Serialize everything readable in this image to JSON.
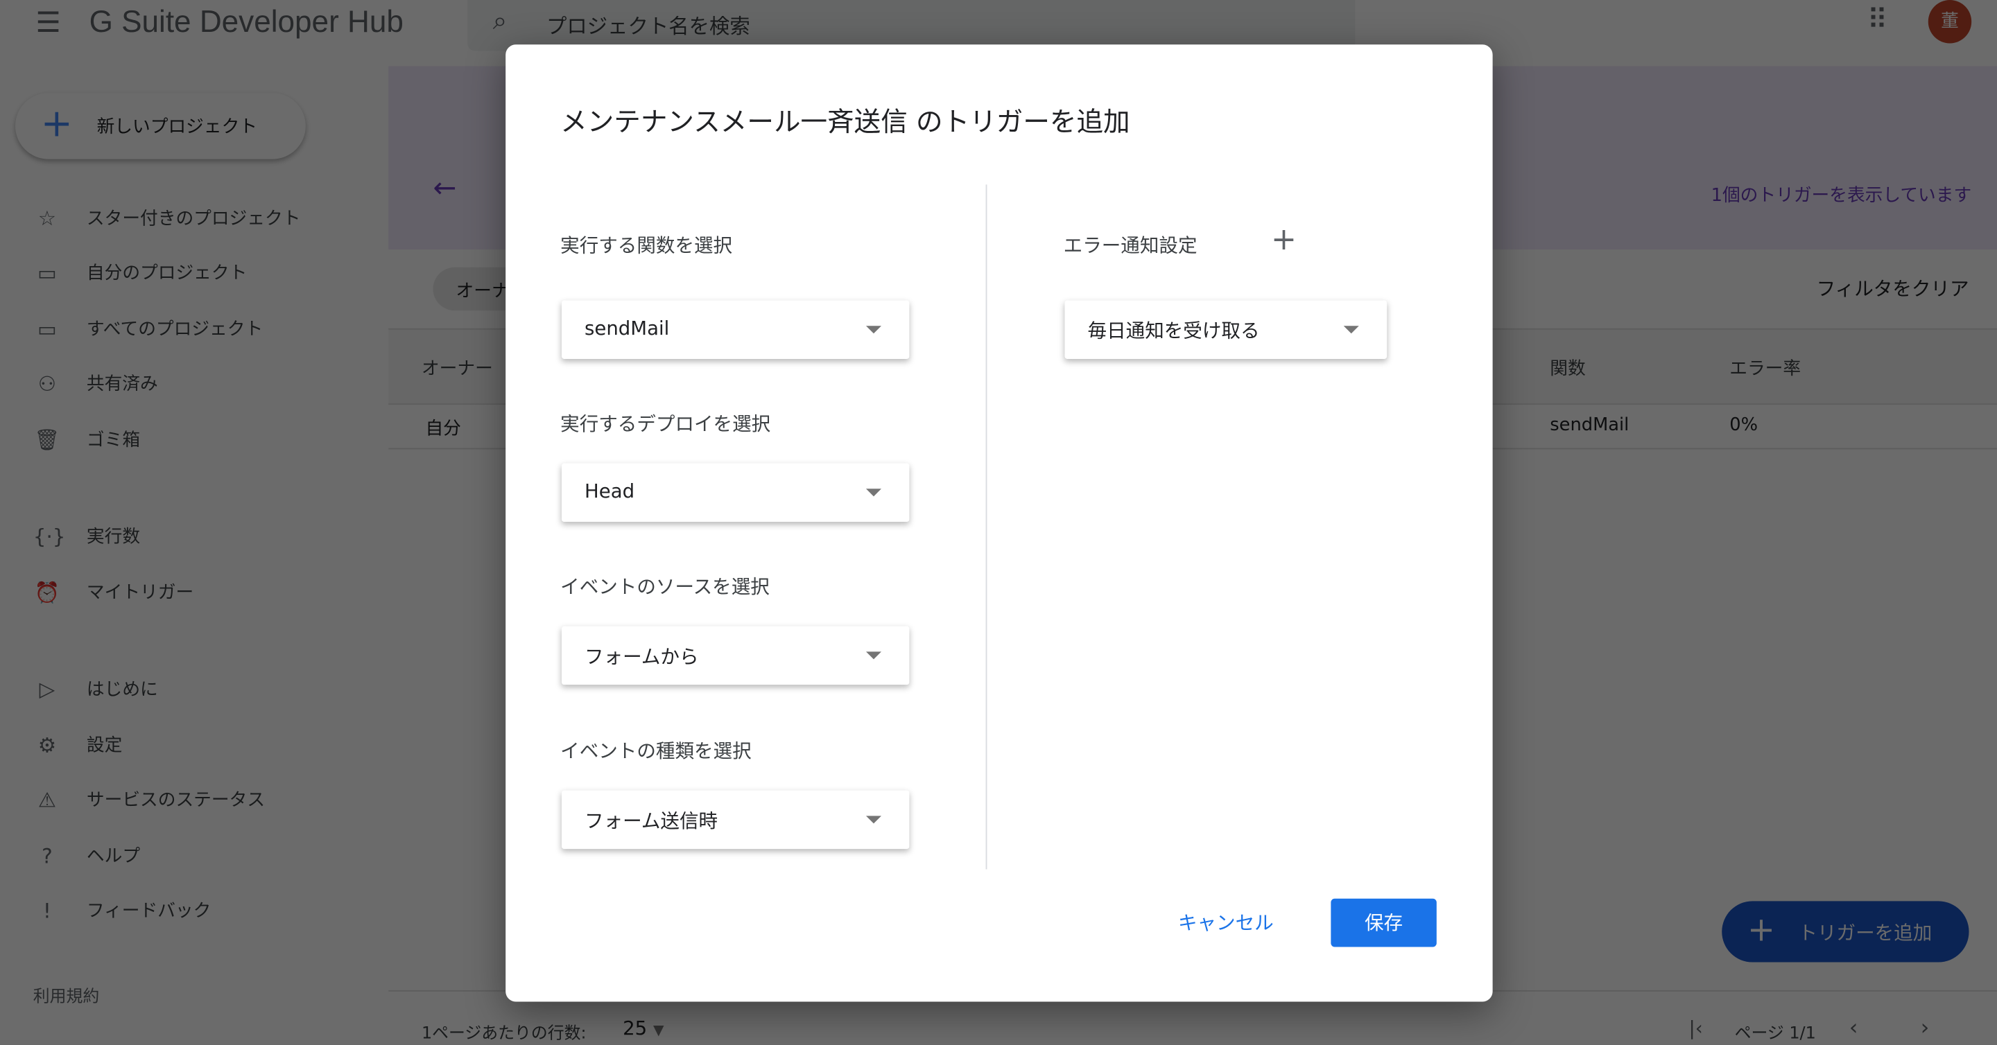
{
  "header": {
    "app_title": "G Suite Developer Hub",
    "search_placeholder": "プロジェクト名を検索",
    "avatar_initial": "董"
  },
  "sidebar": {
    "new_project": "新しいプロジェクト",
    "items": [
      {
        "label": "スター付きのプロジェクト",
        "icon": "star-icon"
      },
      {
        "label": "自分のプロジェクト",
        "icon": "folder-icon"
      },
      {
        "label": "すべてのプロジェクト",
        "icon": "folder-icon"
      },
      {
        "label": "共有済み",
        "icon": "people-icon"
      },
      {
        "label": "ゴミ箱",
        "icon": "trash-icon"
      },
      {
        "label": "実行数",
        "icon": "executions-icon"
      },
      {
        "label": "マイトリガー",
        "icon": "alarm-icon"
      },
      {
        "label": "はじめに",
        "icon": "play-icon"
      },
      {
        "label": "設定",
        "icon": "gear-icon"
      },
      {
        "label": "サービスのステータス",
        "icon": "warning-icon"
      },
      {
        "label": "ヘルプ",
        "icon": "help-icon"
      },
      {
        "label": "フィードバック",
        "icon": "feedback-icon"
      }
    ],
    "terms": "利用規約"
  },
  "main": {
    "trigger_count": "1個のトリガーを表示しています",
    "filter_chip": "オーナ",
    "clear_filter": "フィルタをクリア",
    "columns": [
      "オーナー",
      "関数",
      "エラー率"
    ],
    "rows": [
      {
        "owner": "自分",
        "function": "sendMail",
        "error_rate": "0%"
      }
    ],
    "rows_per_page_label": "1ページあたりの行数:",
    "rows_per_page": "25",
    "page": "ページ 1/1",
    "add_trigger": "トリガーを追加"
  },
  "dialog": {
    "title": "メンテナンスメール一斉送信 のトリガーを追加",
    "function_label": "実行する関数を選択",
    "function_value": "sendMail",
    "deploy_label": "実行するデプロイを選択",
    "deploy_value": "Head",
    "source_label": "イベントのソースを選択",
    "source_value": "フォームから",
    "type_label": "イベントの種類を選択",
    "type_value": "フォーム送信時",
    "error_label": "エラー通知設定",
    "error_value": "毎日通知を受け取る",
    "cancel": "キャンセル",
    "save": "保存"
  },
  "colors": {
    "accent": "#1a73e8",
    "overlay": "rgba(0,0,0,0.6)"
  }
}
